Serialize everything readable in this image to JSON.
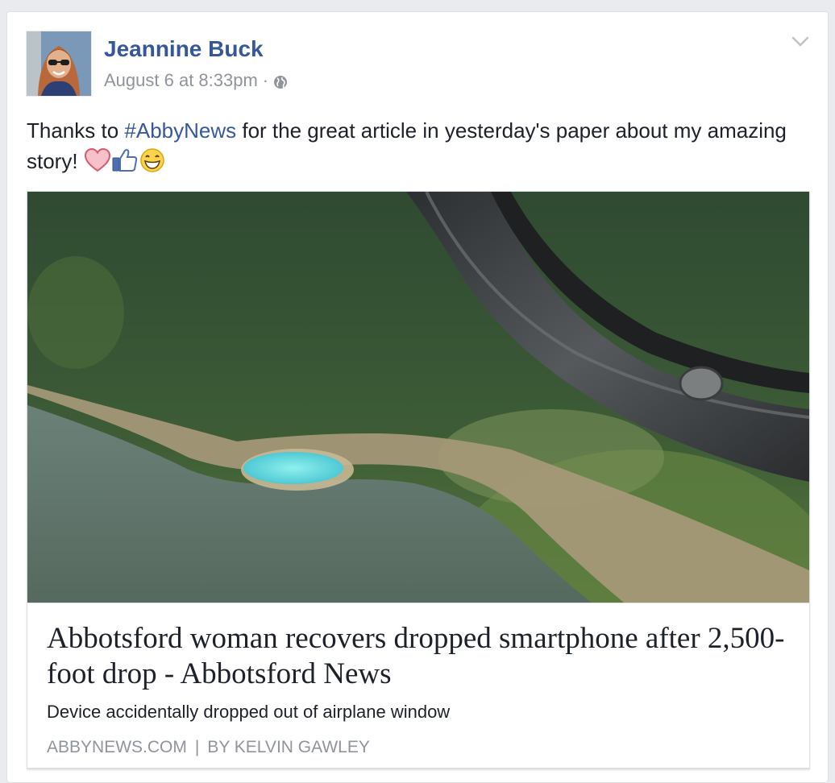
{
  "post": {
    "author": "Jeannine Buck",
    "timestamp": "August 6 at 8:33pm",
    "separator": "·",
    "privacy_icon": "globe-icon",
    "text": {
      "before": "Thanks to ",
      "hashtag": "#AbbyNews",
      "after": " for the great article in yesterday's paper about my amazing story! "
    },
    "emojis": [
      "heart-icon",
      "thumbs-up-icon",
      "grinning-face-icon"
    ]
  },
  "link": {
    "headline": "Abbotsford woman recovers dropped smartphone after 2,500-foot drop - Abbotsford News",
    "description": "Device accidentally dropped out of airplane window",
    "domain": "ABBYNEWS.COM",
    "separator": "|",
    "byline": "BY KELVIN GAWLEY"
  },
  "colors": {
    "author_link": "#365899",
    "hashtag": "#365899",
    "meta_text": "#90949c",
    "body_text": "#1d2129",
    "background": "#e9ebee"
  }
}
